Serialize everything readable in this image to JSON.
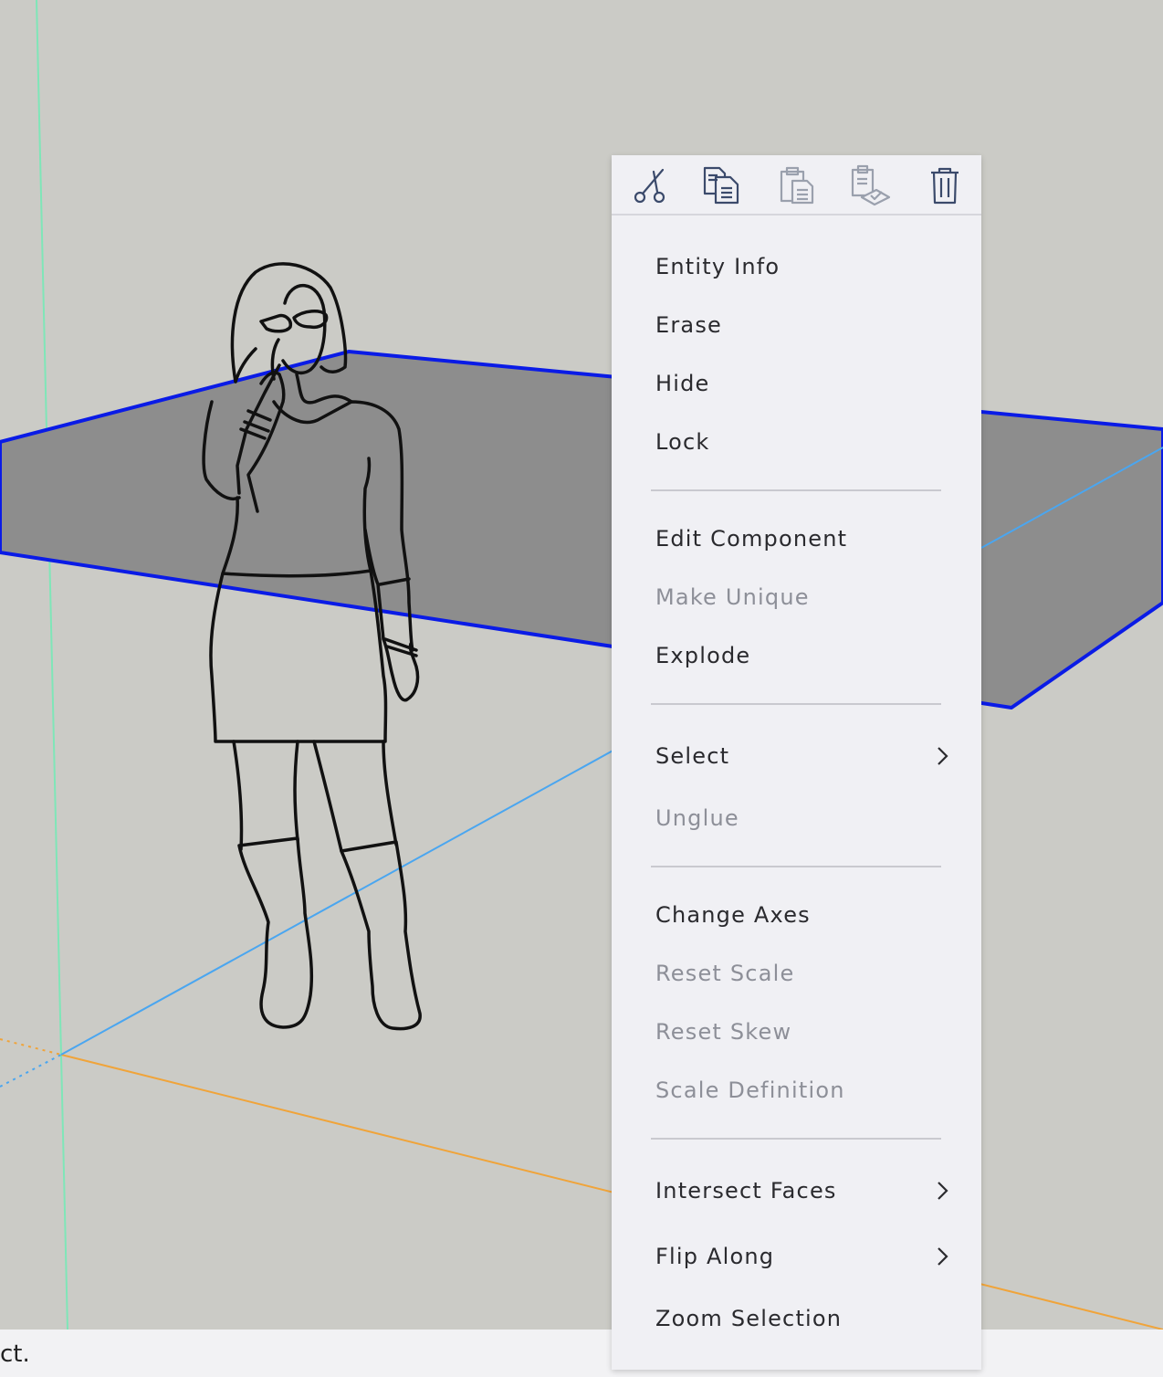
{
  "status_bar": {
    "text": "ct."
  },
  "toolbar": {
    "icons": [
      "scissors-icon",
      "copy-icon",
      "paste-icon",
      "paste-in-place-icon",
      "trash-icon"
    ]
  },
  "menu": {
    "items": [
      {
        "label": "Entity Info",
        "enabled": true
      },
      {
        "label": "Erase",
        "enabled": true
      },
      {
        "label": "Hide",
        "enabled": true
      },
      {
        "label": "Lock",
        "enabled": true
      },
      {
        "label": "Edit Component",
        "enabled": true
      },
      {
        "label": "Make Unique",
        "enabled": false
      },
      {
        "label": "Explode",
        "enabled": true
      },
      {
        "label": "Select",
        "enabled": true,
        "submenu": true
      },
      {
        "label": "Unglue",
        "enabled": false
      },
      {
        "label": "Change Axes",
        "enabled": true
      },
      {
        "label": "Reset Scale",
        "enabled": false
      },
      {
        "label": "Reset Skew",
        "enabled": false
      },
      {
        "label": "Scale Definition",
        "enabled": false
      },
      {
        "label": "Intersect Faces",
        "enabled": true,
        "submenu": true
      },
      {
        "label": "Flip Along",
        "enabled": true,
        "submenu": true
      },
      {
        "label": "Zoom Selection",
        "enabled": true
      }
    ]
  },
  "colors": {
    "background": "#cbcbc6",
    "face": "#8d8d8d",
    "selection_edge": "#0a1be6",
    "green_axis": "#7fe6b8",
    "red_axis": "#f0a43a",
    "blue_axis": "#4aa6f0",
    "menu_bg": "#f0f0f4",
    "text_enabled": "#2a2a2e",
    "text_disabled": "#8d8f98",
    "icon_enabled": "#3b4a6b",
    "icon_disabled": "#9aa0ad"
  }
}
